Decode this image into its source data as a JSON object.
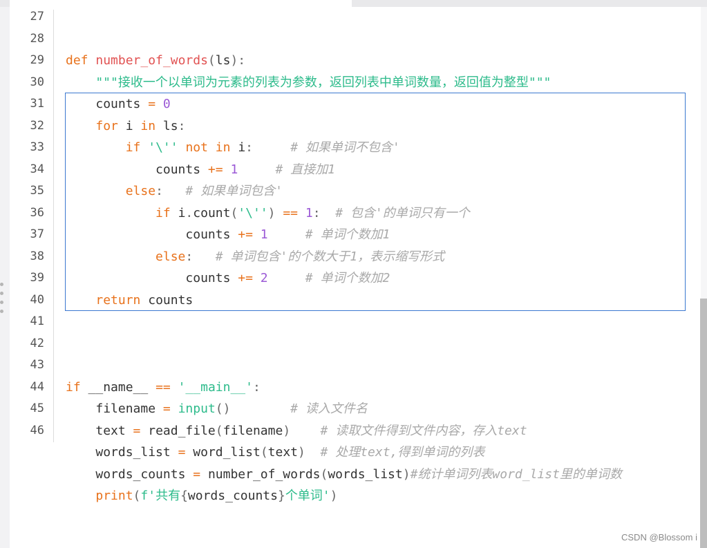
{
  "editor": {
    "line_numbers": [
      "27",
      "28",
      "29",
      "30",
      "31",
      "32",
      "33",
      "34",
      "35",
      "36",
      "37",
      "38",
      "39",
      "40",
      "41",
      "42",
      "43",
      "44",
      "45",
      "46"
    ],
    "lines": {
      "l29": {
        "def": "def ",
        "name": "number_of_words",
        "p1": "(",
        "arg": "ls",
        "p2": "):"
      },
      "l30": {
        "doc": "    \"\"\"接收一个以单词为元素的列表为参数，返回列表中单词数量，返回值为整型\"\"\""
      },
      "l31": {
        "indent": "    ",
        "var": "counts ",
        "op": "=",
        "sp": " ",
        "num": "0"
      },
      "l32": {
        "indent": "    ",
        "for": "for",
        "mid": " i ",
        "in": "in",
        "rest": " ls",
        "colon": ":"
      },
      "l33": {
        "indent": "        ",
        "if": "if",
        "sp": " ",
        "str": "'\\''",
        "sp2": " ",
        "not": "not",
        "sp3": " ",
        "in": "in",
        "rest": " i",
        "colon": ":",
        "cm": "     # 如果单词不包含'"
      },
      "l34": {
        "indent": "            ",
        "var": "counts ",
        "op": "+=",
        "sp": " ",
        "num": "1",
        "cm": "     # 直接加1"
      },
      "l35": {
        "indent": "        ",
        "else": "else",
        "colon": ":",
        "cm": "   # 如果单词包含'"
      },
      "l36": {
        "indent": "            ",
        "if": "if",
        "rest": " i",
        "dot": ".",
        "call": "count",
        "p1": "(",
        "str": "'\\''",
        "p2": ")",
        "sp": " ",
        "op": "==",
        "sp2": " ",
        "num": "1",
        "colon": ":",
        "cm": "  # 包含'的单词只有一个"
      },
      "l37": {
        "indent": "                ",
        "var": "counts ",
        "op": "+=",
        "sp": " ",
        "num": "1",
        "cm": "     # 单词个数加1"
      },
      "l38": {
        "indent": "            ",
        "else": "else",
        "colon": ":",
        "cm": "   # 单词包含'的个数大于1，表示缩写形式"
      },
      "l39": {
        "indent": "                ",
        "var": "counts ",
        "op": "+=",
        "sp": " ",
        "num": "2",
        "cm": "     # 单词个数加2"
      },
      "l40": {
        "indent": "    ",
        "ret": "return",
        "rest": " counts"
      },
      "l44": {
        "if": "if",
        "rest": " __name__ ",
        "op": "==",
        "sp": " ",
        "str": "'__main__'",
        "colon": ":"
      },
      "l45": {
        "indent": "    ",
        "var": "filename ",
        "op": "=",
        "sp": " ",
        "builtin": "input",
        "p": "()",
        "cm": "        # 读入文件名"
      },
      "l46": {
        "indent": "    ",
        "var": "text ",
        "op": "=",
        "sp": " ",
        "call": "read_file",
        "p1": "(",
        "arg": "filename",
        "p2": ")",
        "cm": "    # 读取文件得到文件内容，存入text"
      },
      "l47": {
        "indent": "    ",
        "var": "words_list ",
        "op": "=",
        "sp": " ",
        "call": "word_list",
        "p1": "(",
        "arg": "text",
        "p2": ")",
        "cm": "  # 处理text,得到单词的列表"
      },
      "l48": {
        "indent": "    ",
        "var": "words_counts ",
        "op": "=",
        "sp": " ",
        "call": "number_of_words",
        "p1": "(",
        "arg": "words_list",
        "p2": ")",
        "cm": "#统计单词列表word_list里的单词数"
      },
      "l49": {
        "indent": "    ",
        "builtin": "print",
        "p1": "(",
        "str1": "f'共有",
        "b1": "{",
        "arg": "words_counts",
        "b2": "}",
        "str2": "个单词'",
        "p2": ")"
      }
    }
  },
  "watermark": "CSDN @Blossom i",
  "colors": {
    "keyword": "#e8721c",
    "string": "#2dbb8b",
    "number": "#9b59d6",
    "comment": "#a9a9a9",
    "selection_border": "#3a78d0"
  }
}
